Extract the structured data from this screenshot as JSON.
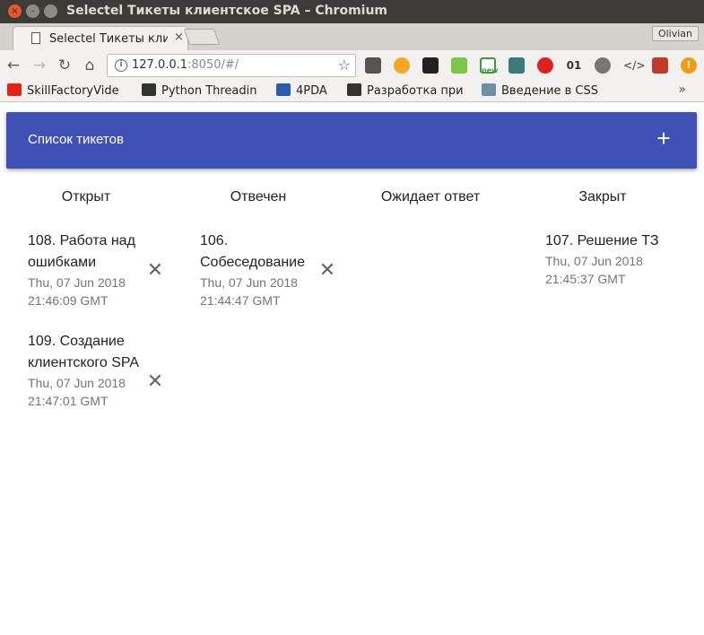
{
  "window": {
    "title": "Selectel Тикеты клиентское SPA – Chromium"
  },
  "tab": {
    "title": "Selectel Тикеты кли",
    "close": "×"
  },
  "profile": {
    "name": "Olivian"
  },
  "omnibox": {
    "url_host": "127.0.0.1",
    "url_rest": ":8050/#/"
  },
  "extensions": [
    {
      "icon": "radio-icon",
      "color": "#555555"
    },
    {
      "icon": "radiation-icon",
      "color": "#f5a623"
    },
    {
      "icon": "gnome-icon",
      "color": "#222222"
    },
    {
      "icon": "green-square-icon",
      "color": "#7cc846"
    },
    {
      "icon": "new-badge-icon",
      "color": "#3d9a3d",
      "label": "new"
    },
    {
      "icon": "eclipse-icon",
      "color": "#3b7a7a"
    },
    {
      "icon": "opera-icon",
      "color": "#e0201f"
    },
    {
      "icon": "binary-icon",
      "color": "#333333",
      "label": "01"
    },
    {
      "icon": "gear-icon",
      "color": "#777777"
    },
    {
      "icon": "code-icon",
      "color": "#666666",
      "label": "</>"
    },
    {
      "icon": "bug-icon",
      "color": "#c0392b"
    },
    {
      "icon": "alert-icon",
      "color": "#f39c12",
      "label": "!"
    }
  ],
  "bookmarks": [
    {
      "label": "SkillFactoryVide",
      "icon": "youtube-icon",
      "color": "#e62117"
    },
    {
      "label": "Python Threadin",
      "icon": "waveform-icon",
      "color": "#333333"
    },
    {
      "label": "4PDA",
      "icon": "4pda-icon",
      "color": "#2a5db0"
    },
    {
      "label": "Разработка при",
      "icon": "habr-icon",
      "color": "#333333"
    },
    {
      "label": "Введение в CSS",
      "icon": "h-icon",
      "color": "#6d8fa8"
    }
  ],
  "bookmarks_more": "»",
  "app": {
    "title": "Список тикетов",
    "add_label": "+",
    "columns": [
      "Открыт",
      "Отвечен",
      "Ожидает ответ",
      "Закрыт"
    ],
    "accent": "#3f51b5",
    "tickets": {
      "open": [
        {
          "title": "108. Работа над ошибками",
          "date": "Thu, 07 Jun 2018 21:46:09 GMT"
        },
        {
          "title": "109. Создание клиентского SPA",
          "date": "Thu, 07 Jun 2018 21:47:01 GMT"
        }
      ],
      "answered": [
        {
          "title": "106. Собеседование",
          "date": "Thu, 07 Jun 2018 21:44:47 GMT"
        }
      ],
      "closed": [
        {
          "title": "107. Решение ТЗ",
          "date": "Thu, 07 Jun 2018 21:45:37 GMT"
        }
      ]
    },
    "delete_symbol": "✕"
  }
}
